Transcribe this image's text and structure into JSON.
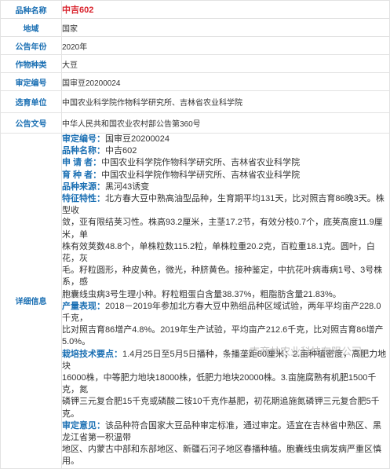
{
  "rows": [
    {
      "label": "品种名称",
      "value": "中吉602"
    },
    {
      "label": "地域",
      "value": "国家"
    },
    {
      "label": "公告年份",
      "value": "2020年"
    },
    {
      "label": "作物种类",
      "value": "大豆"
    },
    {
      "label": "审定编号",
      "value": "国审豆20200024"
    },
    {
      "label": "选育单位",
      "value": "中国农业科学院作物科学研究所、吉林省农业科学院"
    },
    {
      "label": "公告文号",
      "value": "中华人民共和国农业农村部公告第360号"
    }
  ],
  "detail_label": "详细信息",
  "detail": {
    "approval_key": "审定编号：",
    "approval_val": "国审豆20200024",
    "name_key": "品种名称：",
    "name_val": "中吉602",
    "applicant_key": "申 请 者：",
    "applicant_val": "中国农业科学院作物科学研究所、吉林省农业科学院",
    "breeder_key": "育 种 者：",
    "breeder_val": "中国农业科学院作物科学研究所、吉林省农业科学院",
    "source_key": "品种来源：",
    "source_val": "黑河43诱变",
    "traits_key": "特征特性：",
    "traits_1": "北方春大豆中熟高油型品种，生育期平均131天，比对照吉育86晚3天。株型收",
    "traits_2": "敛，亚有限结荚习性。株高93.2厘米，主茎17.2节，有效分枝0.7个，底荚高度11.9厘米，单",
    "traits_3": "株有效荚数48.8个，单株粒数115.2粒，单株粒重20.2克，百粒重18.1克。圆叶，白花，灰",
    "traits_4": "毛。籽粒圆形，种皮黄色，微光，种脐黄色。接种鉴定，中抗花叶病毒病1号、3号株系，感",
    "traits_5": "胞囊线虫病3号生理小种。籽粒粗蛋白含量38.37%，粗脂肪含量21.83%。",
    "yield_key": "产量表现：",
    "yield_1": "2018－2019年参加北方春大豆中熟组品种区域试验，两年平均亩产228.0千克，",
    "yield_2": "比对照吉育86增产4.8%。2019年生产试验，平均亩产212.6千克，比对照吉育86增产",
    "yield_3": "5.0%。",
    "cult_key": "栽培技术要点：",
    "cult_1": "1.4月25日至5月5日播种，条播垄距60厘米；2.亩种植密度，高肥力地块",
    "cult_2": "16000株，中等肥力地块18000株，低肥力地块20000株。3.亩施腐熟有机肥1500千克，氮",
    "cult_3": "磷钾三元复合肥15千克或磷酸二铵10千克作基肥，初花期追施氮磷钾三元复合肥5千克。",
    "opinion_key": "审定意见：",
    "opinion_1": "该品种符合国家大豆品种审定标准，通过审定。适宜在吉林省中熟区、黑龙江省第一积温带",
    "opinion_2": "地区、内蒙古中部和东部地区、新疆石河子地区春播种植。胞囊线虫病发病严重区慎用。"
  },
  "watermark": "吉商林农业科技有限公司"
}
